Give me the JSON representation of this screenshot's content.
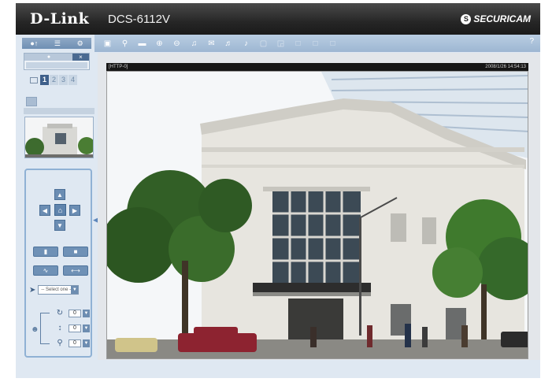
{
  "header": {
    "brand": "D-Link",
    "model": "DCS-6112V",
    "product_logo": "SECURICAM"
  },
  "sidebar": {
    "top_icons": [
      "user-icon",
      "list-icon",
      "gear-icon"
    ],
    "stream_tabs": [
      "1",
      "2",
      "3",
      "4"
    ],
    "active_stream": "1",
    "ptz": {
      "preset_placeholder": "-- Select one --",
      "speed_values": [
        "0",
        "0",
        "0"
      ]
    }
  },
  "toolbar": {
    "icons": [
      "snapshot-icon",
      "digital-zoom-icon",
      "record-icon",
      "zoom-icon",
      "zoom-out-icon",
      "listen-icon",
      "talk-icon",
      "volume-icon",
      "mute-icon",
      "fullscreen-icon",
      "pip-icon",
      "pan-icon",
      "patrol-icon",
      "preset-icon"
    ],
    "help": "?"
  },
  "video": {
    "overlay_left": "[HTTP-0]",
    "overlay_right": "2008/1/26 14:54:13"
  },
  "colors": {
    "header_bg": "#262626",
    "toolbar_bg": "#a9c0d9",
    "panel_bg": "#dfe8f2",
    "accent": "#3e5f8a"
  }
}
